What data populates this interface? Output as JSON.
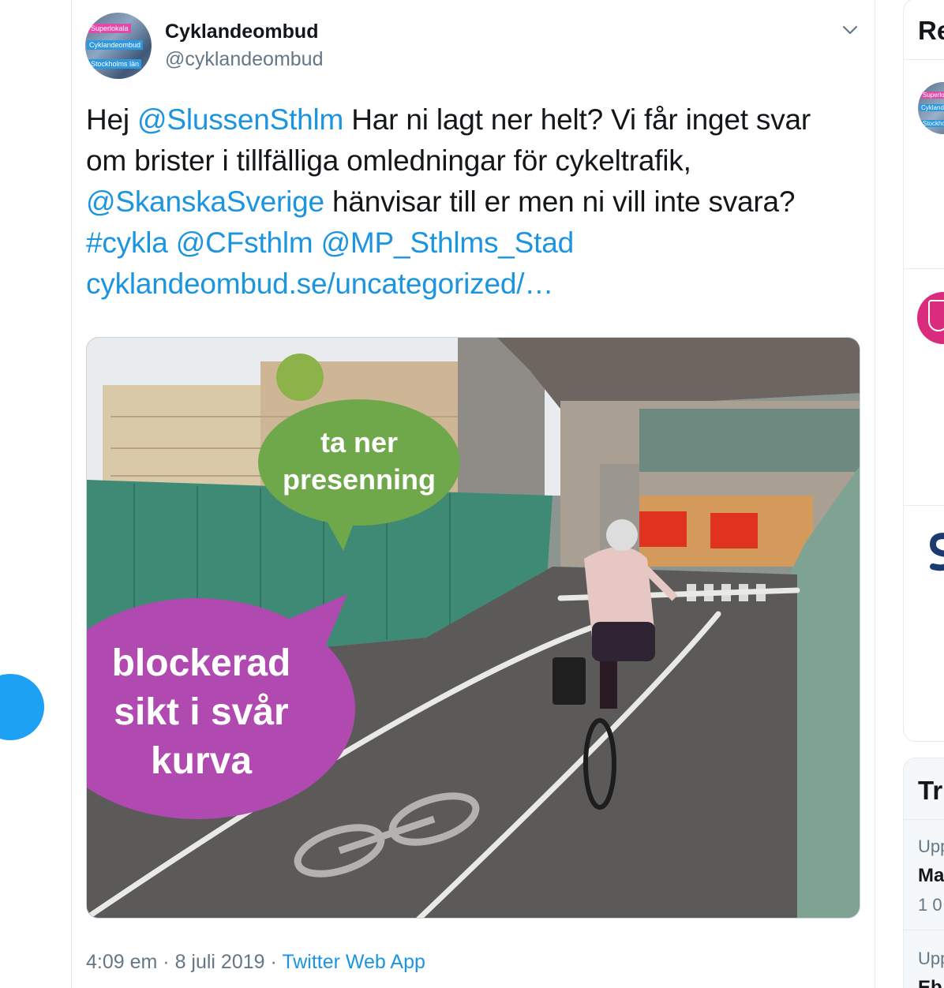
{
  "tweet": {
    "display_name": "Cyklandeombud",
    "handle": "@cyklandeombud",
    "avatar_tags": [
      "Superlokala",
      "Cyklandeombud",
      "Stockholms län"
    ],
    "text": {
      "l1_a": "Hej ",
      "l1_mention": "@SlussenSthlm",
      "l1_b": " Har ni lagt ner helt? Vi får inget svar",
      "l2": "om brister i tillfälliga omledningar för cykeltrafik,",
      "l3_mention": "@SkanskaSverige",
      "l3_b": " hänvisar till er men ni vill inte svara?",
      "l4_hashtag": "#cykla",
      "l4_mention1": "@CFsthlm",
      "l4_mention2": "@MP_Sthlms_Stad",
      "l5_link": "cyklandeombud.se/uncategorized/…"
    },
    "image": {
      "bubble_green_l1": "ta ner",
      "bubble_green_l2": "presenning",
      "bubble_purple_l1": "blockerad",
      "bubble_purple_l2": "sikt i svår",
      "bubble_purple_l3": "kurva"
    },
    "time": "4:09 em",
    "date": "8 juli 2019",
    "source": "Twitter Web App"
  },
  "sidebar": {
    "title": "Re",
    "avatar_tags": [
      "Superlokala",
      "Cyklande",
      "Stockholm"
    ],
    "trends_title": "Tr",
    "trends": [
      {
        "sub": "Upp",
        "name": "Ma",
        "count": "1 0"
      },
      {
        "sub": "Upp",
        "name": "Eb",
        "count": ""
      }
    ]
  },
  "colors": {
    "link": "#1b95e0",
    "secondary_text": "#657786",
    "primary_text": "#14171a",
    "fab": "#1da1f2",
    "bubble_green": "#6fa84a",
    "bubble_purple": "#b04ab0"
  }
}
